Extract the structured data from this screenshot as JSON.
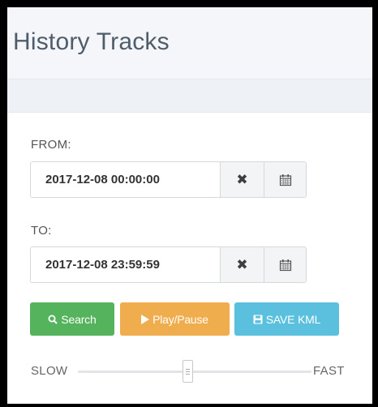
{
  "header": {
    "title": "History Tracks"
  },
  "from": {
    "label": "FROM:",
    "value": "2017-12-08 00:00:00",
    "clear_icon": "times-icon",
    "calendar_icon": "calendar-icon"
  },
  "to": {
    "label": "TO:",
    "value": "2017-12-08 23:59:59",
    "clear_icon": "times-icon",
    "calendar_icon": "calendar-icon"
  },
  "buttons": {
    "search": {
      "label": "Search",
      "icon": "search-icon",
      "color": "#54b35c"
    },
    "play_pause": {
      "label": "Play/Pause",
      "icon": "play-icon",
      "color": "#f0ad4e"
    },
    "save_kml": {
      "label": "SAVE KML",
      "icon": "floppy-disk-icon",
      "color": "#5bc0de"
    }
  },
  "speed": {
    "slow_label": "SLOW",
    "fast_label": "FAST",
    "level": 0.5
  }
}
